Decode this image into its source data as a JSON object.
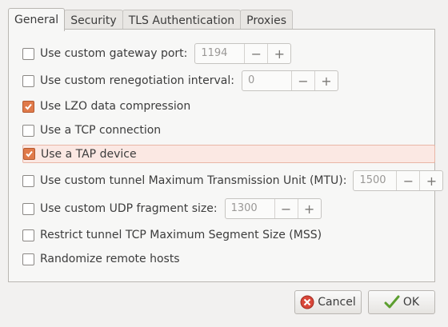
{
  "tabs": [
    "General",
    "Security",
    "TLS Authentication",
    "Proxies"
  ],
  "options": [
    {
      "label": "Use custom gateway port:",
      "checked": false,
      "value": "1194"
    },
    {
      "label": "Use custom renegotiation interval:",
      "checked": false,
      "value": "0"
    },
    {
      "label": "Use LZO data compression",
      "checked": true
    },
    {
      "label": "Use a TCP connection",
      "checked": false
    },
    {
      "label": "Use a TAP device",
      "checked": true
    },
    {
      "label": "Use custom tunnel Maximum Transmission Unit (MTU):",
      "checked": false,
      "value": "1500"
    },
    {
      "label": "Use custom UDP fragment size:",
      "checked": false,
      "value": "1300"
    },
    {
      "label": "Restrict tunnel TCP Maximum Segment Size (MSS)",
      "checked": false
    },
    {
      "label": "Randomize remote hosts",
      "checked": false
    }
  ],
  "stepper": {
    "minus": "−",
    "plus": "+"
  },
  "buttons": {
    "cancel": "Cancel",
    "ok": "OK"
  },
  "colors": {
    "accent": "#e07a4a",
    "highlight_bg": "#fbe8e3"
  }
}
